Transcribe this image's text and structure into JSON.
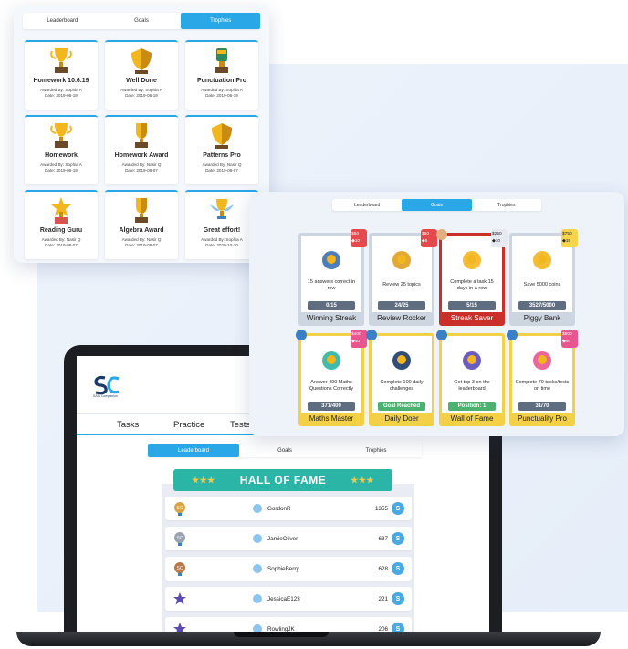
{
  "trophies_panel": {
    "tabs": [
      "Leaderboard",
      "Goals",
      "Trophies"
    ],
    "active_tab": "Trophies",
    "cards": [
      {
        "name": "Homework 10.6.19",
        "awarded_by": "Awarded By: Sophia A",
        "date": "Date: 2019-06-19",
        "icon": "gold-trophy-icon"
      },
      {
        "name": "Well Done",
        "awarded_by": "Awarded By: Sophia A",
        "date": "Date: 2019-06-19",
        "icon": "gold-shield-icon"
      },
      {
        "name": "Punctuation Pro",
        "awarded_by": "Awarded By: Sophia A",
        "date": "Date: 2019-06-19",
        "icon": "green-trophy-icon"
      },
      {
        "name": "Homework",
        "awarded_by": "Awarded By: Sophia A",
        "date": "Date: 2019-06-19",
        "icon": "gold-cup-icon"
      },
      {
        "name": "Homework Award",
        "awarded_by": "Awarded By: Nasir Q",
        "date": "Date: 2019-08-07",
        "icon": "gold-award-icon"
      },
      {
        "name": "Patterns Pro",
        "awarded_by": "Awarded By: Nasir Q",
        "date": "Date: 2019-08-07",
        "icon": "gold-shield-icon"
      },
      {
        "name": "Reading Guru",
        "awarded_by": "Awarded By: Nasir Q",
        "date": "Date: 2019-08-07",
        "icon": "star-trophy-icon"
      },
      {
        "name": "Algebra Award",
        "awarded_by": "Awarded By: Nasir Q",
        "date": "Date: 2019-08-07",
        "icon": "gold-award-icon"
      },
      {
        "name": "Great effort!",
        "awarded_by": "Awarded By: Sophia A",
        "date": "Date: 2020-10-30",
        "icon": "winged-trophy-icon"
      }
    ]
  },
  "goals_panel": {
    "tabs": [
      "Leaderboard",
      "Goals",
      "Trophies"
    ],
    "active_tab": "Goals",
    "cards": [
      {
        "name": "Winning Streak",
        "desc": "15 answers correct in row",
        "progress": "0/15",
        "style": "grey",
        "badge": {
          "coins": "50",
          "gems": "10",
          "color": "r"
        }
      },
      {
        "name": "Review Rocker",
        "desc": "Review 25 topics",
        "progress": "24/25",
        "style": "grey",
        "badge": {
          "coins": "50",
          "gems": "5",
          "color": "r"
        }
      },
      {
        "name": "Streak Saver",
        "desc": "Complete a task 15 days in a row",
        "progress": "5/15",
        "style": "red",
        "badge": {
          "coins": "250",
          "gems": "10",
          "color": "grey"
        }
      },
      {
        "name": "Piggy Bank",
        "desc": "Save 5000 coins",
        "progress": "3527/5000",
        "style": "grey",
        "badge": {
          "coins": "750",
          "gems": "15",
          "color": "y"
        }
      },
      {
        "name": "Maths Master",
        "desc": "Answer 400 Maths Questions Correctly",
        "progress": "371/400",
        "style": "yellow",
        "badge": {
          "coins": "400",
          "gems": "40",
          "color": "p"
        }
      },
      {
        "name": "Daily Doer",
        "desc": "Complete 100 daily challenges",
        "progress": "Goal Reached",
        "style": "yellow",
        "badge": null
      },
      {
        "name": "Wall of Fame",
        "desc": "Get top 3 on the leaderboard",
        "progress": "Position: 1",
        "style": "yellow",
        "badge": null
      },
      {
        "name": "Punctuality Pro",
        "desc": "Complete 70 tasks/tests on time",
        "progress": "31/70",
        "style": "yellow",
        "badge": {
          "coins": "600",
          "gems": "40",
          "color": "p"
        }
      }
    ]
  },
  "laptop_app": {
    "logo_text": "SATs Companion",
    "nav": [
      "Tasks",
      "Practice",
      "Tests"
    ],
    "tabs": [
      "Leaderboard",
      "Goals",
      "Trophies"
    ],
    "active_tab": "Leaderboard",
    "hall_of_fame_title": "HALL OF FAME",
    "rows": [
      {
        "name": "GordonR",
        "score": "1355",
        "medal": "gold"
      },
      {
        "name": "JamieOliver",
        "score": "637",
        "medal": "silver"
      },
      {
        "name": "SophieBerry",
        "score": "628",
        "medal": "bronze"
      },
      {
        "name": "JessicaE123",
        "score": "221",
        "medal": "star"
      },
      {
        "name": "RowlingJK",
        "score": "206",
        "medal": "star"
      }
    ],
    "coin_symbol": "S"
  }
}
